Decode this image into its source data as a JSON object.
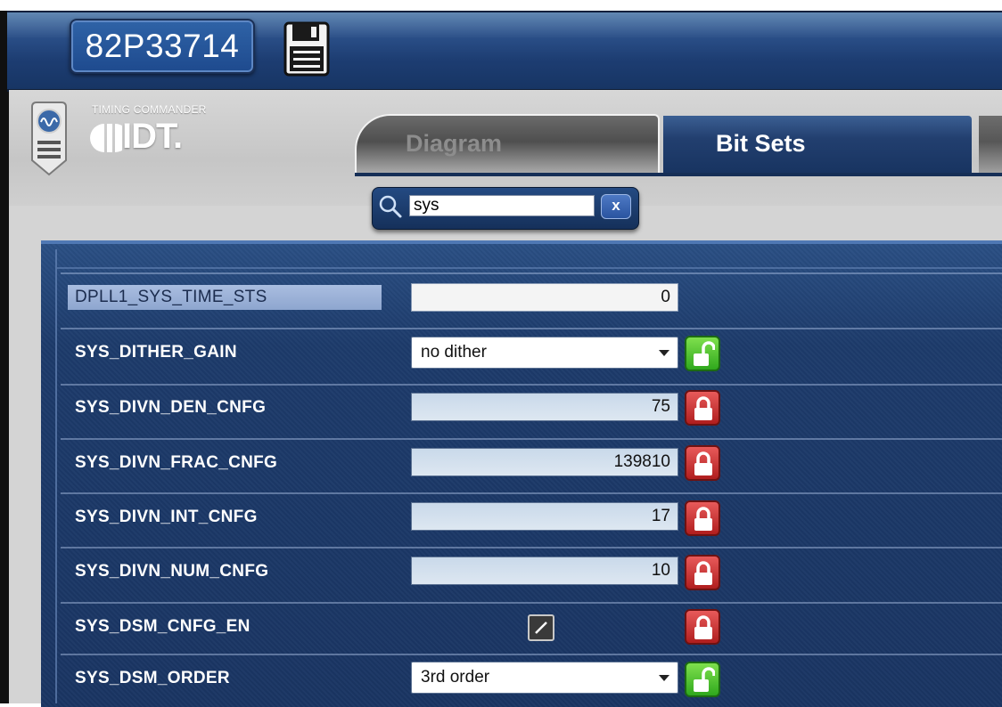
{
  "header": {
    "device_name": "82P33714",
    "save_icon": "floppy-disk-icon"
  },
  "brand": {
    "product": "TIMING COMMANDER",
    "company": "IDT."
  },
  "tabs": [
    {
      "label": "Diagram",
      "active": false
    },
    {
      "label": "Bit Sets",
      "active": true
    }
  ],
  "search": {
    "value": "sys",
    "clear_label": "x",
    "icon": "magnifier-icon"
  },
  "params": [
    {
      "name": "DPLL1_SYS_TIME_STS",
      "kind": "readonly",
      "value": "0",
      "lock": "none",
      "highlighted": true
    },
    {
      "name": "SYS_DITHER_GAIN",
      "kind": "dropdown",
      "value": "no dither",
      "lock": "unlocked"
    },
    {
      "name": "SYS_DIVN_DEN_CNFG",
      "kind": "number",
      "value": "75",
      "lock": "locked"
    },
    {
      "name": "SYS_DIVN_FRAC_CNFG",
      "kind": "number",
      "value": "139810",
      "lock": "locked"
    },
    {
      "name": "SYS_DIVN_INT_CNFG",
      "kind": "number",
      "value": "17",
      "lock": "locked"
    },
    {
      "name": "SYS_DIVN_NUM_CNFG",
      "kind": "number",
      "value": "10",
      "lock": "locked"
    },
    {
      "name": "SYS_DSM_CNFG_EN",
      "kind": "checkbox",
      "value": "",
      "lock": "locked"
    },
    {
      "name": "SYS_DSM_ORDER",
      "kind": "dropdown",
      "value": "3rd order",
      "lock": "unlocked"
    }
  ],
  "colors": {
    "header_blue": "#1d3d72",
    "panel_blue": "#1d3b6b",
    "lock_red": "#c62828",
    "lock_green": "#3cb52a"
  }
}
